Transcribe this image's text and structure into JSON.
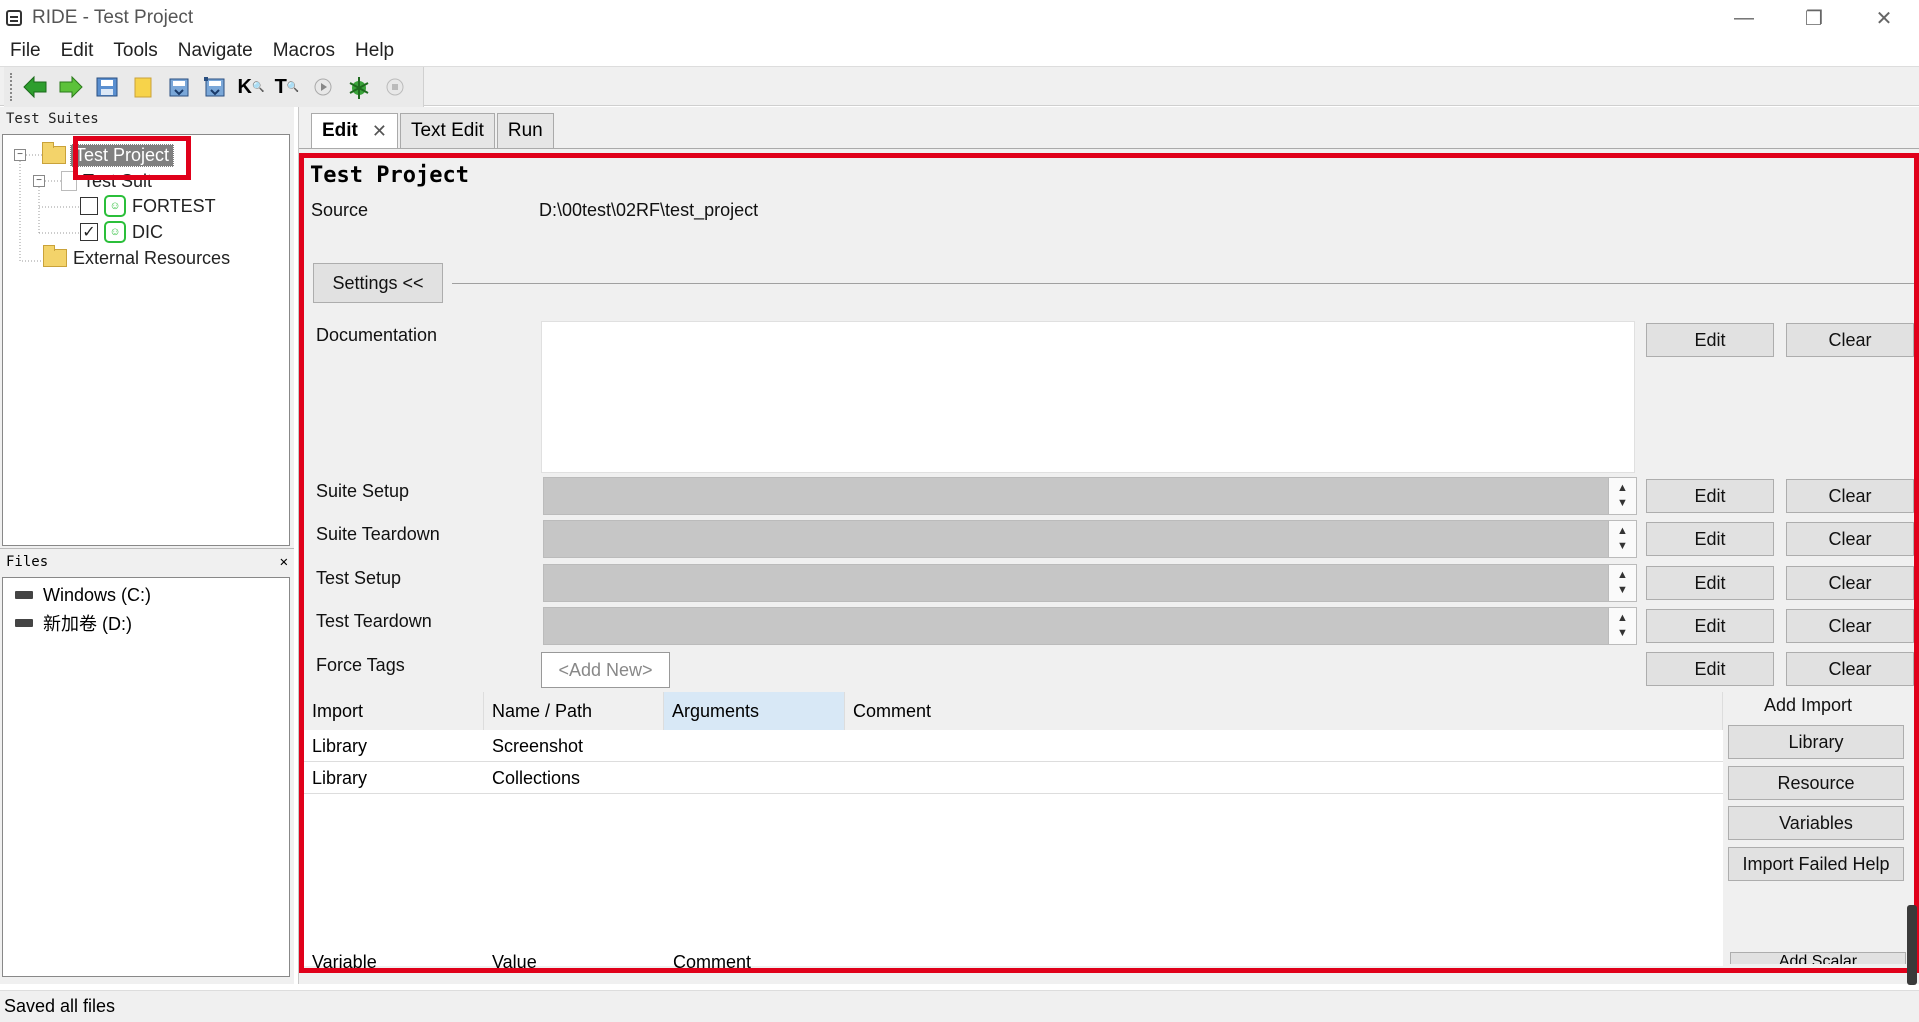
{
  "window": {
    "title": "RIDE - Test Project",
    "minimize": "—",
    "restore": "❐",
    "close": "✕"
  },
  "menu": [
    "File",
    "Edit",
    "Tools",
    "Navigate",
    "Macros",
    "Help"
  ],
  "toolbar": {
    "icons": [
      "back-arrow-icon",
      "forward-arrow-icon",
      "save-icon",
      "folder-icon",
      "save-as-icon",
      "save-all-icon",
      "search-keywords-icon",
      "search-tests-icon",
      "run-icon",
      "debug-bug-icon",
      "stop-icon"
    ],
    "k_glyph": "K",
    "t_glyph": "T"
  },
  "left": {
    "test_suites_header": "Test Suites",
    "tree": {
      "root": "Test Project",
      "suite": "Test Suit",
      "tests": [
        {
          "label": "FORTEST",
          "checked": false
        },
        {
          "label": "DIC",
          "checked": true
        }
      ],
      "external": "External Resources"
    },
    "files_header": "Files",
    "files_close": "✕",
    "drives": [
      "Windows (C:)",
      "新加卷 (D:)"
    ]
  },
  "tabs": [
    {
      "label": "Edit",
      "active": true,
      "closable": true
    },
    {
      "label": "Text Edit",
      "active": false
    },
    {
      "label": "Run",
      "active": false
    }
  ],
  "editor": {
    "title": "Test Project",
    "source_label": "Source",
    "source_value": "D:\\00test\\02RF\\test_project",
    "settings_button": "Settings <<",
    "fields": {
      "documentation": "Documentation",
      "suite_setup": "Suite Setup",
      "suite_teardown": "Suite Teardown",
      "test_setup": "Test Setup",
      "test_teardown": "Test Teardown",
      "force_tags": "Force Tags"
    },
    "edit_label": "Edit",
    "clear_label": "Clear",
    "add_new": "<Add New>",
    "import_headers": [
      "Import",
      "Name / Path",
      "Arguments",
      "Comment"
    ],
    "imports": [
      {
        "type": "Library",
        "name": "Screenshot"
      },
      {
        "type": "Library",
        "name": "Collections"
      }
    ],
    "add_import_label": "Add Import",
    "add_import_buttons": [
      "Library",
      "Resource",
      "Variables",
      "Import Failed Help"
    ],
    "variable_headers": [
      "Variable",
      "Value",
      "Comment"
    ],
    "add_scalar": "Add Scalar"
  },
  "status": "Saved all files"
}
